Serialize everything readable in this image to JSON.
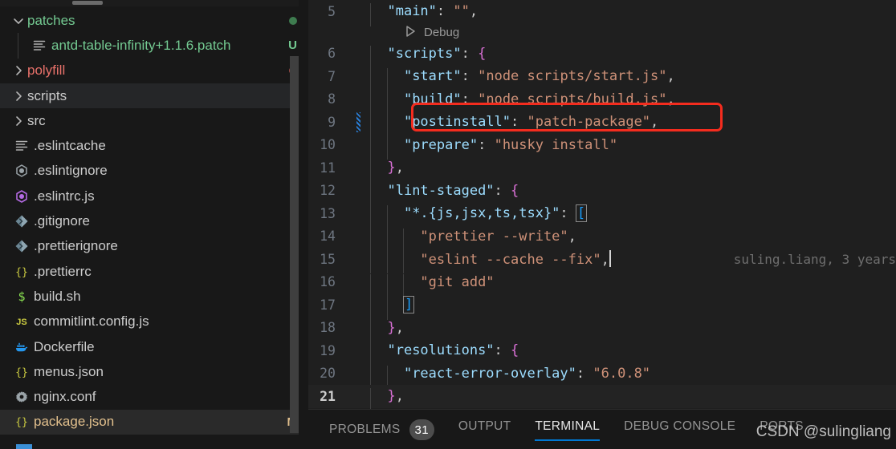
{
  "sidebar": {
    "items": [
      {
        "label": "patches",
        "kind": "folder",
        "expanded": true,
        "icon": "chevron-down-icon",
        "color": "green",
        "badge": "",
        "dot": "green",
        "selected": false,
        "indentGuide": false
      },
      {
        "label": "antd-table-infinity+1.1.6.patch",
        "kind": "file",
        "expanded": false,
        "icon": "lines-file-icon",
        "color": "green",
        "badge": "U",
        "badgeColor": "green",
        "dot": "",
        "selected": false,
        "indentGuide": true
      },
      {
        "label": "polyfill",
        "kind": "folder",
        "expanded": false,
        "icon": "chevron-right-icon",
        "color": "red",
        "badge": "",
        "dot": "red",
        "selected": false,
        "indentGuide": false
      },
      {
        "label": "scripts",
        "kind": "folder",
        "expanded": false,
        "icon": "chevron-right-icon",
        "color": "",
        "badge": "",
        "dot": "",
        "selected": true,
        "indentGuide": false
      },
      {
        "label": "src",
        "kind": "folder",
        "expanded": false,
        "icon": "chevron-right-icon",
        "color": "",
        "badge": "",
        "dot": "",
        "selected": false,
        "indentGuide": false
      },
      {
        "label": ".eslintcache",
        "kind": "file",
        "icon": "lines-file-icon",
        "color": "",
        "badge": "",
        "dot": "",
        "selected": false,
        "indentGuide": false
      },
      {
        "label": ".eslintignore",
        "kind": "file",
        "icon": "eslint-gray-icon",
        "color": "",
        "badge": "",
        "dot": "",
        "selected": false,
        "indentGuide": false
      },
      {
        "label": ".eslintrc.js",
        "kind": "file",
        "icon": "eslint-purple-icon",
        "color": "",
        "badge": "",
        "dot": "",
        "selected": false,
        "indentGuide": false
      },
      {
        "label": ".gitignore",
        "kind": "file",
        "icon": "git-diamond-icon",
        "color": "",
        "badge": "",
        "dot": "",
        "selected": false,
        "indentGuide": false
      },
      {
        "label": ".prettierignore",
        "kind": "file",
        "icon": "git-diamond-icon",
        "color": "",
        "badge": "",
        "dot": "",
        "selected": false,
        "indentGuide": false
      },
      {
        "label": ".prettierrc",
        "kind": "file",
        "icon": "json-braces-icon",
        "color": "",
        "badge": "",
        "dot": "",
        "selected": false,
        "indentGuide": false
      },
      {
        "label": "build.sh",
        "kind": "file",
        "icon": "shell-dollar-icon",
        "color": "",
        "badge": "",
        "dot": "",
        "selected": false,
        "indentGuide": false
      },
      {
        "label": "commitlint.config.js",
        "kind": "file",
        "icon": "js-icon",
        "color": "",
        "badge": "",
        "dot": "",
        "selected": false,
        "indentGuide": false
      },
      {
        "label": "Dockerfile",
        "kind": "file",
        "icon": "docker-whale-icon",
        "color": "",
        "badge": "",
        "dot": "",
        "selected": false,
        "indentGuide": false
      },
      {
        "label": "menus.json",
        "kind": "file",
        "icon": "json-braces-icon",
        "color": "",
        "badge": "",
        "dot": "",
        "selected": false,
        "indentGuide": false
      },
      {
        "label": "nginx.conf",
        "kind": "file",
        "icon": "gear-icon",
        "color": "",
        "badge": "",
        "dot": "",
        "selected": false,
        "indentGuide": false
      },
      {
        "label": "package.json",
        "kind": "file",
        "icon": "json-braces-icon",
        "color": "amber",
        "badge": "M",
        "badgeColor": "amber",
        "dot": "",
        "selected": false,
        "activeFile": true,
        "indentGuide": false
      }
    ]
  },
  "editor": {
    "file": "package.json",
    "codelens": {
      "label": "Debug",
      "icon": "play-icon"
    },
    "blame": {
      "line": 15,
      "text": "suling.liang, 3 years"
    },
    "highlight": {
      "line": 9,
      "color": "#f42c1e"
    },
    "lines": [
      {
        "num": "5",
        "text": "  \"main\": \"\","
      },
      {
        "num": "6",
        "text": "  \"scripts\": {"
      },
      {
        "num": "7",
        "text": "    \"start\": \"node scripts/start.js\","
      },
      {
        "num": "8",
        "text": "    \"build\": \"node scripts/build.js\","
      },
      {
        "num": "9",
        "text": "    \"postinstall\": \"patch-package\","
      },
      {
        "num": "10",
        "text": "    \"prepare\": \"husky install\""
      },
      {
        "num": "11",
        "text": "  },"
      },
      {
        "num": "12",
        "text": "  \"lint-staged\": {"
      },
      {
        "num": "13",
        "text": "    \"*.{js,jsx,ts,tsx}\": ["
      },
      {
        "num": "14",
        "text": "      \"prettier --write\","
      },
      {
        "num": "15",
        "text": "      \"eslint --cache --fix\","
      },
      {
        "num": "16",
        "text": "      \"git add\""
      },
      {
        "num": "17",
        "text": "    ]"
      },
      {
        "num": "18",
        "text": "  },"
      },
      {
        "num": "19",
        "text": "  \"resolutions\": {"
      },
      {
        "num": "20",
        "text": "    \"react-error-overlay\": \"6.0.8\""
      },
      {
        "num": "21",
        "text": "  },"
      }
    ]
  },
  "panel": {
    "tabs": [
      {
        "label": "PROBLEMS",
        "badge": "31",
        "active": false
      },
      {
        "label": "OUTPUT",
        "badge": "",
        "active": false
      },
      {
        "label": "TERMINAL",
        "badge": "",
        "active": true
      },
      {
        "label": "DEBUG CONSOLE",
        "badge": "",
        "active": false
      },
      {
        "label": "PORTS",
        "badge": "",
        "active": false
      }
    ]
  },
  "watermark": {
    "text": "CSDN @sulingliang"
  },
  "colors": {
    "accent": "#0078d4",
    "highlight": "#f42c1e",
    "green": "#73c991",
    "red": "#e8716a",
    "amber": "#e2c08d",
    "string": "#ce9178",
    "key": "#9cdcfe",
    "brace": "#da70d6",
    "bracket": "#179fff"
  }
}
